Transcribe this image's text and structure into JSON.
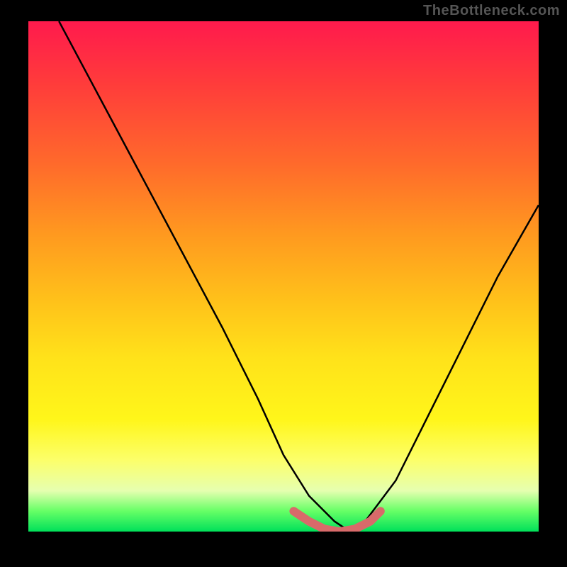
{
  "watermark": "TheBottleneck.com",
  "chart_data": {
    "type": "line",
    "title": "",
    "xlabel": "",
    "ylabel": "",
    "xlim": [
      0,
      100
    ],
    "ylim": [
      0,
      100
    ],
    "grid": false,
    "legend": false,
    "series": [
      {
        "name": "curve",
        "x": [
          6,
          14,
          22,
          30,
          38,
          45,
          50,
          55,
          60,
          63,
          66,
          72,
          78,
          85,
          92,
          100
        ],
        "y": [
          100,
          85,
          70,
          55,
          40,
          26,
          15,
          7,
          2,
          0,
          2,
          10,
          22,
          36,
          50,
          64
        ],
        "color": "#000000"
      },
      {
        "name": "optimal-range-marker",
        "x": [
          52,
          55,
          58,
          61,
          64,
          67,
          69
        ],
        "y": [
          4,
          2,
          0.5,
          0,
          0.5,
          2,
          4
        ],
        "color": "#d86a6a"
      }
    ],
    "background_gradient": {
      "direction": "vertical",
      "stops": [
        {
          "pos": 0.0,
          "color": "#ff1a4d"
        },
        {
          "pos": 0.12,
          "color": "#ff3b3b"
        },
        {
          "pos": 0.28,
          "color": "#ff6a2b"
        },
        {
          "pos": 0.42,
          "color": "#ff9a1f"
        },
        {
          "pos": 0.55,
          "color": "#ffc21a"
        },
        {
          "pos": 0.66,
          "color": "#ffe21a"
        },
        {
          "pos": 0.78,
          "color": "#fff61a"
        },
        {
          "pos": 0.86,
          "color": "#fcff6a"
        },
        {
          "pos": 0.92,
          "color": "#e6ffb0"
        },
        {
          "pos": 0.96,
          "color": "#66ff66"
        },
        {
          "pos": 1.0,
          "color": "#00e05a"
        }
      ]
    }
  }
}
